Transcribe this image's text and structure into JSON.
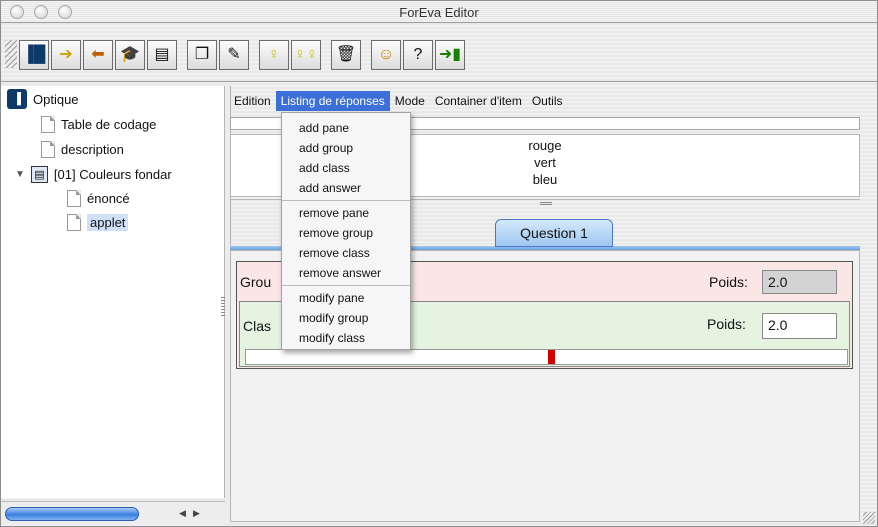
{
  "window": {
    "title": "ForEva Editor"
  },
  "toolbar": {
    "buttons": [
      {
        "icon": "open-book-icon"
      },
      {
        "icon": "import-book-icon"
      },
      {
        "icon": "export-book-icon"
      },
      {
        "icon": "graduation-cap-icon"
      },
      {
        "icon": "list-icon"
      },
      {
        "icon": "copy-pages-icon"
      },
      {
        "icon": "edit-page-icon"
      },
      {
        "icon": "lightbulb-icon"
      },
      {
        "icon": "two-lightbulbs-icon"
      },
      {
        "icon": "trash-icon"
      },
      {
        "icon": "face-icon"
      },
      {
        "icon": "question-drop-icon"
      },
      {
        "icon": "exit-door-icon"
      }
    ]
  },
  "tree": {
    "root": "Optique",
    "items": [
      {
        "label": "Table de codage",
        "type": "document"
      },
      {
        "label": "description",
        "type": "document"
      },
      {
        "label": "[01] Couleurs fondar",
        "type": "list"
      },
      {
        "label": "énoncé",
        "type": "document"
      },
      {
        "label": "applet",
        "type": "document",
        "selected": true
      }
    ]
  },
  "menubar": {
    "items": [
      "Edition",
      "Listing de réponses",
      "Mode",
      "Container d'item",
      "Outils"
    ],
    "active": "Listing de réponses"
  },
  "dropdown": {
    "groups": [
      [
        "add pane",
        "add group",
        "add class",
        "add answer"
      ],
      [
        "remove pane",
        "remove group",
        "remove class",
        "remove answer"
      ],
      [
        "modify pane",
        "modify group",
        "modify class"
      ]
    ]
  },
  "answers": [
    "rouge",
    "vert",
    "bleu"
  ],
  "tab": {
    "label": "Question 1"
  },
  "group": {
    "label": "Grou",
    "poids_label": "Poids:",
    "poids_value": "2.0"
  },
  "class": {
    "label": "Clas",
    "poids_label": "Poids:",
    "poids_value": "2.0"
  },
  "colors": {
    "menu_highlight": "#3d6fd8",
    "group_background": "#fbe6e6",
    "class_background": "#e4f4e1",
    "marker": "#d40000",
    "tab": "#9fc7f1"
  }
}
